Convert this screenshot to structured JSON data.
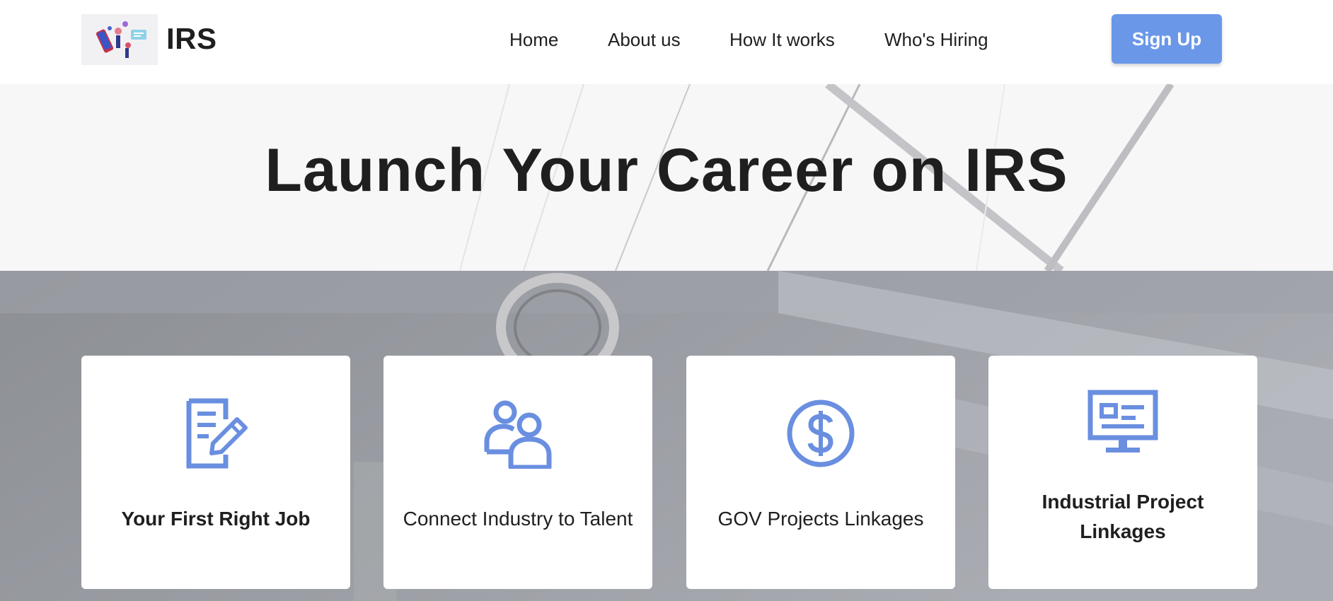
{
  "header": {
    "brand": "IRS",
    "nav": [
      "Home",
      "About us",
      "How It works",
      "Who's Hiring"
    ],
    "signup_label": "Sign Up"
  },
  "hero": {
    "title": "Launch Your Career on IRS"
  },
  "cards": [
    {
      "label": "Your First Right Job",
      "icon": "document-edit-icon"
    },
    {
      "label": "Connect Industry to Talent",
      "icon": "users-icon"
    },
    {
      "label": "GOV Projects Linkages",
      "icon": "dollar-circle-icon"
    },
    {
      "label": "Industrial Project Linkages",
      "icon": "monitor-icon"
    }
  ],
  "colors": {
    "accent": "#6a97e8",
    "text": "#1f1f1f",
    "icon": "#6a8fe0"
  }
}
